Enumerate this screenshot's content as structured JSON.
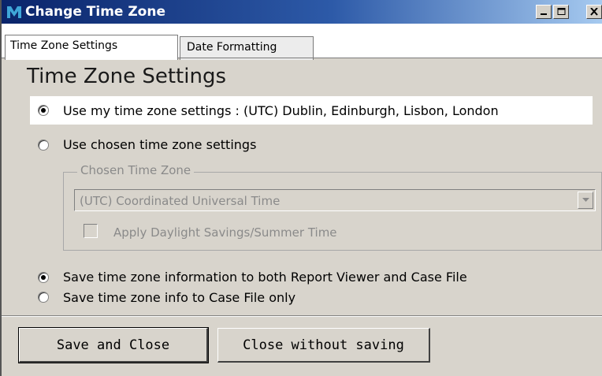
{
  "window": {
    "title": "Change Time Zone"
  },
  "tabs": [
    {
      "label": "Time Zone Settings",
      "active": true
    },
    {
      "label": "Date Formatting",
      "active": false
    }
  ],
  "section_title": "Time Zone Settings",
  "options": {
    "use_my": {
      "label": "Use my time zone settings : (UTC) Dublin, Edinburgh, Lisbon, London",
      "checked": true
    },
    "use_chosen": {
      "label": "Use chosen time zone settings",
      "checked": false
    }
  },
  "chosen_group": {
    "legend": "Chosen Time Zone",
    "combo_value": "(UTC) Coordinated Universal Time",
    "daylight_label": "Apply Daylight Savings/Summer Time",
    "daylight_checked": false
  },
  "save_options": {
    "both": {
      "label": "Save time zone information to both Report Viewer and Case File",
      "checked": true
    },
    "case_only": {
      "label": "Save time zone info to Case File only",
      "checked": false
    }
  },
  "buttons": {
    "save_close": "Save and Close",
    "close_nosave": "Close without saving"
  },
  "colors": {
    "titlebar_start": "#0a246a",
    "titlebar_end": "#a6caf0",
    "dialog_bg": "#d8d4cc"
  }
}
